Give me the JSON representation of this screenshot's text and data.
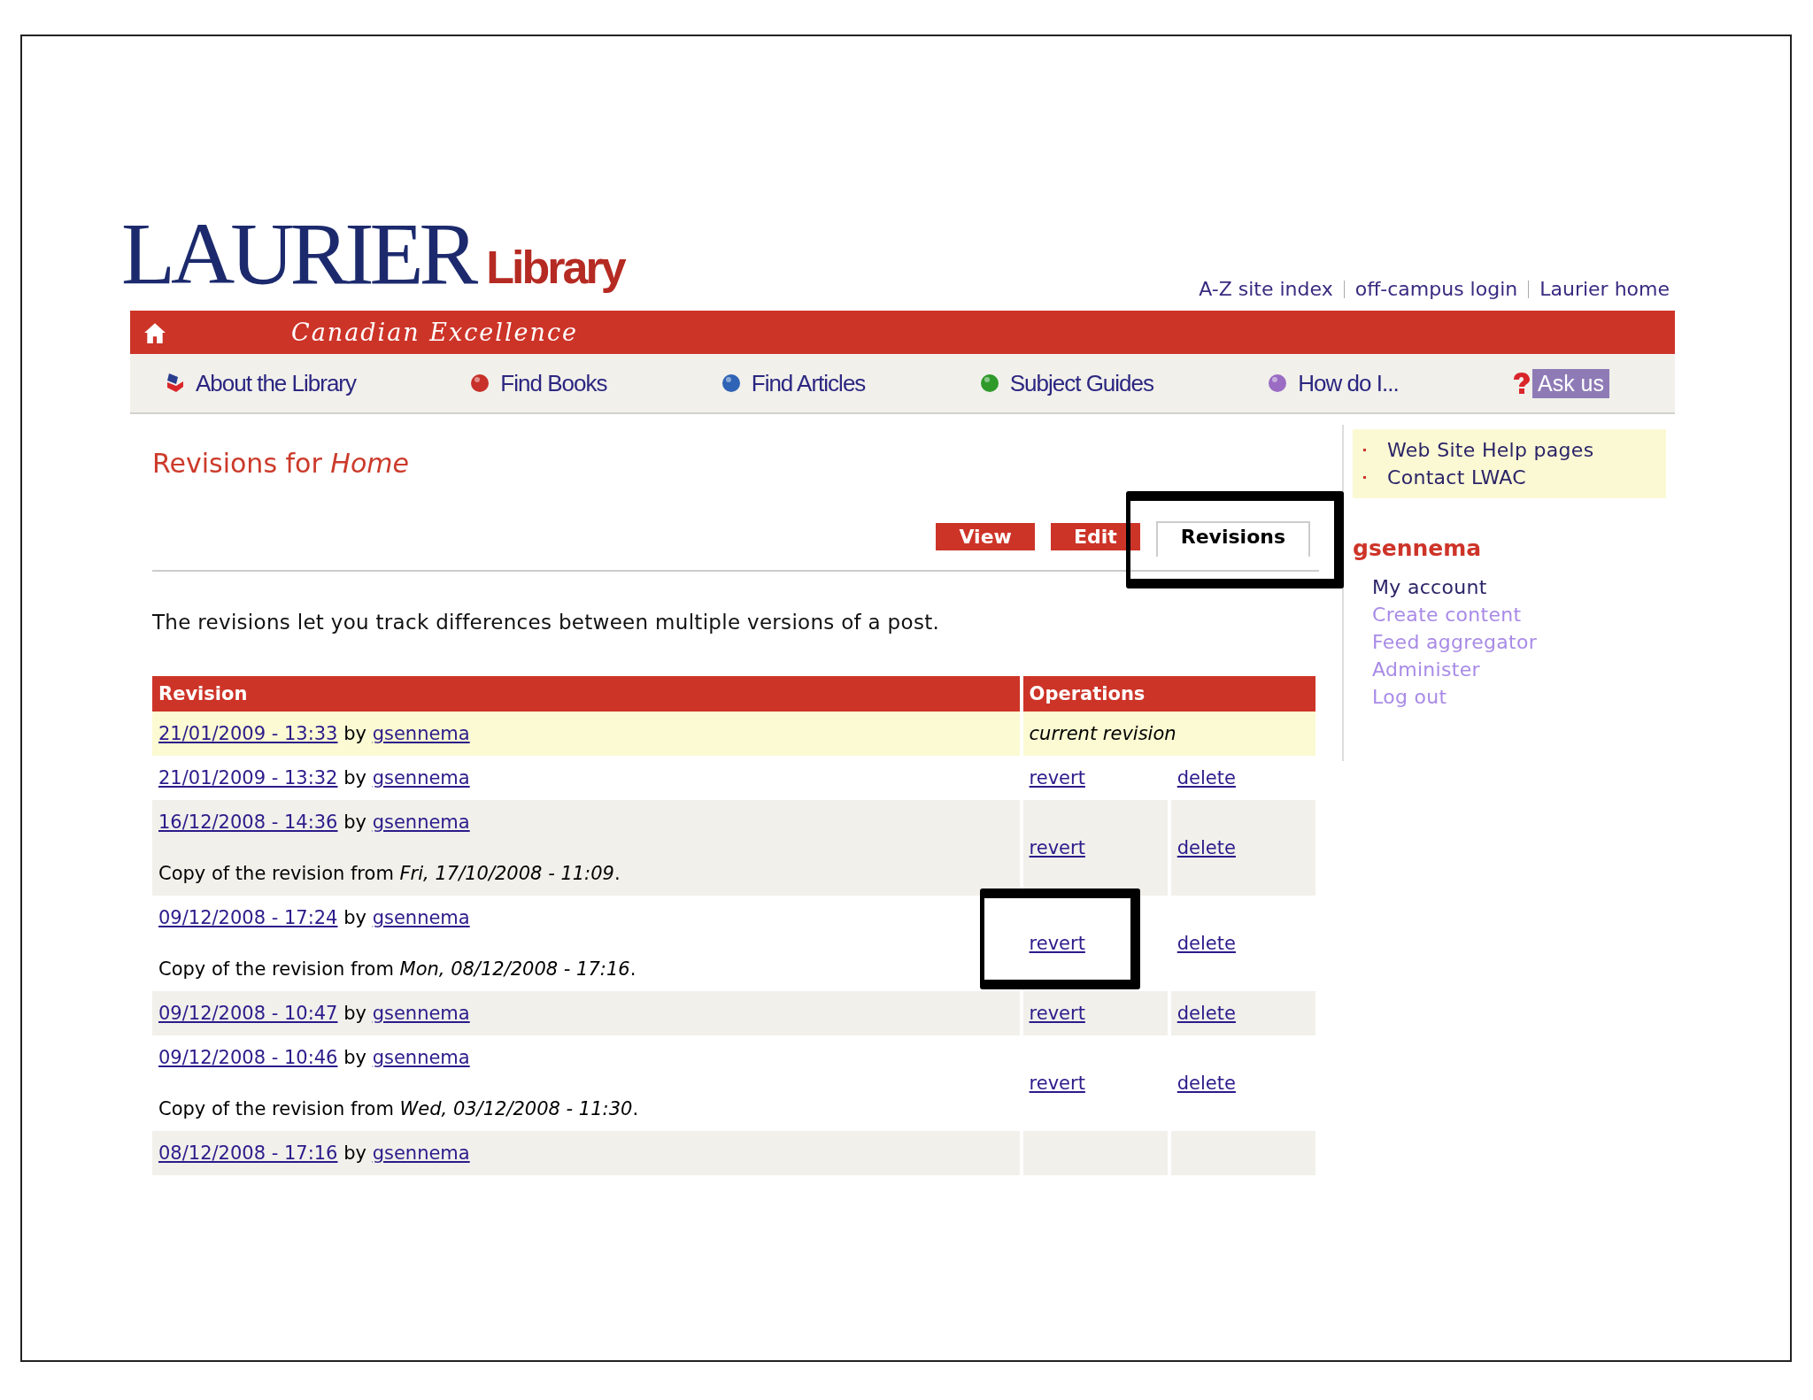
{
  "header": {
    "logo_main": "LAURIER",
    "logo_sub": "Library",
    "top_links": [
      "A-Z site index",
      "off-campus login",
      "Laurier home"
    ],
    "tagline": "Canadian Excellence"
  },
  "nav": [
    {
      "label": "About the Library",
      "kind": "book"
    },
    {
      "label": "Find Books",
      "kind": "ball",
      "color": "#c8302a"
    },
    {
      "label": "Find Articles",
      "kind": "ball",
      "color": "#2f63b5"
    },
    {
      "label": "Subject Guides",
      "kind": "ball",
      "color": "#2f9a2a"
    },
    {
      "label": "How do I...",
      "kind": "ball",
      "color": "#9a6cc4"
    },
    {
      "label": "Ask us",
      "kind": "ask"
    }
  ],
  "page": {
    "title": "Revisions for *Home*",
    "tabs": [
      {
        "label": "View",
        "selected": false,
        "annotated": false
      },
      {
        "label": "Edit",
        "selected": false,
        "annotated": false
      },
      {
        "label": "Revisions",
        "selected": true,
        "annotated": true
      }
    ],
    "description": "The revisions let you track differences between multiple versions of a post."
  },
  "table": {
    "columns": [
      "Revision",
      "Operations"
    ],
    "rows": [
      {
        "date": "21/01/2009 - 13:33",
        "by": "by",
        "author": "gsennema",
        "current": true,
        "status": "current revision"
      },
      {
        "date": "21/01/2009 - 13:32",
        "by": "by",
        "author": "gsennema",
        "current": false,
        "operations": [
          {
            "label": "revert",
            "annotated": false
          },
          {
            "label": "delete",
            "annotated": false
          }
        ]
      },
      {
        "date": "16/12/2008 - 14:36",
        "by": "by",
        "author": "gsennema",
        "current": false,
        "log": "Copy of the revision from *Fri, 17/10/2008 - 11:09*.",
        "operations": [
          {
            "label": "revert",
            "annotated": false
          },
          {
            "label": "delete",
            "annotated": false
          }
        ]
      },
      {
        "date": "09/12/2008 - 17:24",
        "by": "by",
        "author": "gsennema",
        "current": false,
        "log": "Copy of the revision from *Mon, 08/12/2008 - 17:16*.",
        "operations": [
          {
            "label": "revert",
            "annotated": true
          },
          {
            "label": "delete",
            "annotated": false
          }
        ]
      },
      {
        "date": "09/12/2008 - 10:47",
        "by": "by",
        "author": "gsennema",
        "current": false,
        "operations": [
          {
            "label": "revert",
            "annotated": false
          },
          {
            "label": "delete",
            "annotated": false
          }
        ]
      },
      {
        "date": "09/12/2008 - 10:46",
        "by": "by",
        "author": "gsennema",
        "current": false,
        "log": "Copy of the revision from *Wed, 03/12/2008 - 11:30*.",
        "operations": [
          {
            "label": "revert",
            "annotated": false
          },
          {
            "label": "delete",
            "annotated": false
          }
        ]
      },
      {
        "date": "08/12/2008 - 17:16",
        "by": "by",
        "author": "gsennema",
        "current": false
      }
    ]
  },
  "sidebar": {
    "help_links": [
      "Web Site Help pages",
      "Contact LWAC"
    ],
    "user": {
      "name": "gsennema",
      "links": [
        {
          "label": "My account",
          "visited": false
        },
        {
          "label": "Create content",
          "visited": true
        },
        {
          "label": "Feed aggregator",
          "visited": true
        },
        {
          "label": "Administer",
          "visited": true
        },
        {
          "label": "Log out",
          "visited": true
        }
      ]
    }
  }
}
